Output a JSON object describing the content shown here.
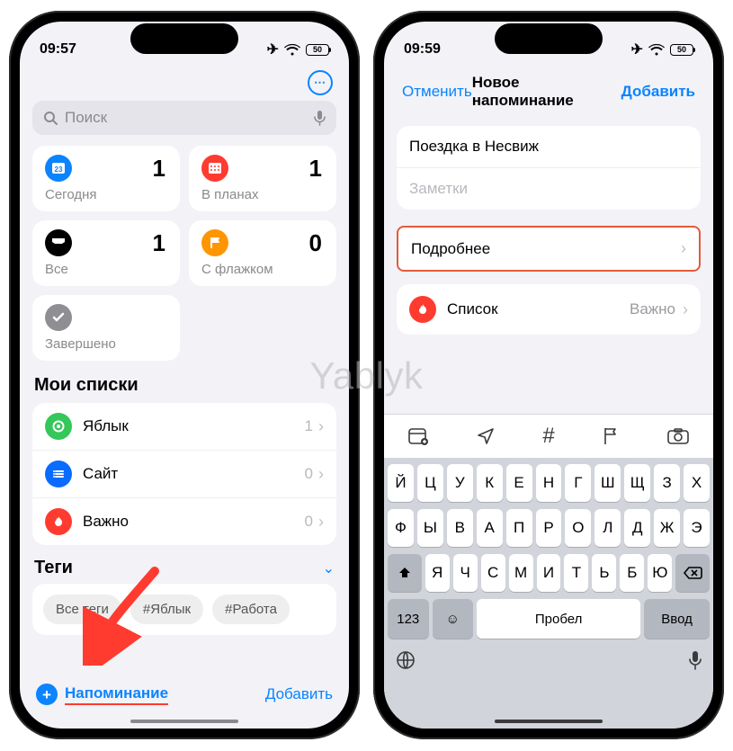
{
  "watermark": "Yablyk",
  "left": {
    "status": {
      "time": "09:57",
      "battery": "50"
    },
    "more_icon": "⋯",
    "search": {
      "placeholder": "Поиск"
    },
    "cards": {
      "today": {
        "label": "Сегодня",
        "count": "1"
      },
      "scheduled": {
        "label": "В планах",
        "count": "1"
      },
      "all": {
        "label": "Все",
        "count": "1"
      },
      "flagged": {
        "label": "С флажком",
        "count": "0"
      },
      "completed": {
        "label": "Завершено"
      }
    },
    "lists_title": "Мои списки",
    "lists": [
      {
        "name": "Яблык",
        "count": "1"
      },
      {
        "name": "Сайт",
        "count": "0"
      },
      {
        "name": "Важно",
        "count": "0"
      }
    ],
    "tags_title": "Теги",
    "tag_chips": [
      "Все теги",
      "#Яблык",
      "#Работа"
    ],
    "bottom": {
      "new_reminder": "Напоминание",
      "add_list": "Добавить"
    }
  },
  "right": {
    "status": {
      "time": "09:59",
      "battery": "50"
    },
    "nav": {
      "cancel": "Отменить",
      "title": "Новое напоминание",
      "done": "Добавить"
    },
    "form": {
      "title_value": "Поездка в Несвиж",
      "notes_placeholder": "Заметки",
      "details_label": "Подробнее",
      "list_label": "Список",
      "list_value": "Важно"
    },
    "keyboard": {
      "row1": [
        "Й",
        "Ц",
        "У",
        "К",
        "Е",
        "Н",
        "Г",
        "Ш",
        "Щ",
        "З",
        "Х"
      ],
      "row2": [
        "Ф",
        "Ы",
        "В",
        "А",
        "П",
        "Р",
        "О",
        "Л",
        "Д",
        "Ж",
        "Э"
      ],
      "row3": [
        "Я",
        "Ч",
        "С",
        "М",
        "И",
        "Т",
        "Ь",
        "Б",
        "Ю"
      ],
      "numbers": "123",
      "space": "Пробел",
      "enter": "Ввод"
    }
  }
}
